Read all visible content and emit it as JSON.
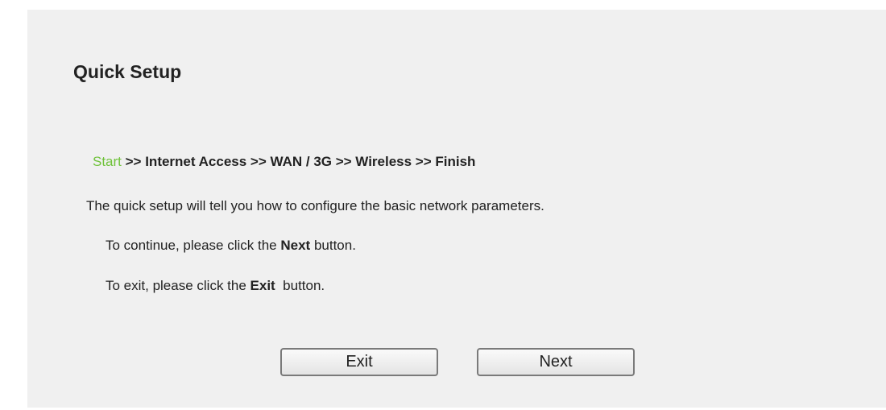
{
  "page": {
    "title": "Quick Setup"
  },
  "steps": {
    "current": "Start",
    "rest": " >> Internet Access >> WAN / 3G >> Wireless >> Finish"
  },
  "content": {
    "description": "The quick setup will tell you how to configure the basic network parameters.",
    "continue_prefix": "To continue, please click the ",
    "continue_bold": "Next",
    "continue_suffix": " button.",
    "exit_prefix": "To exit, please click the ",
    "exit_bold": "Exit",
    "exit_suffix": "  button."
  },
  "buttons": {
    "exit_label": "Exit",
    "next_label": "Next"
  },
  "colors": {
    "panel_background": "#f0f0f0",
    "current_step": "#6fc23a"
  }
}
